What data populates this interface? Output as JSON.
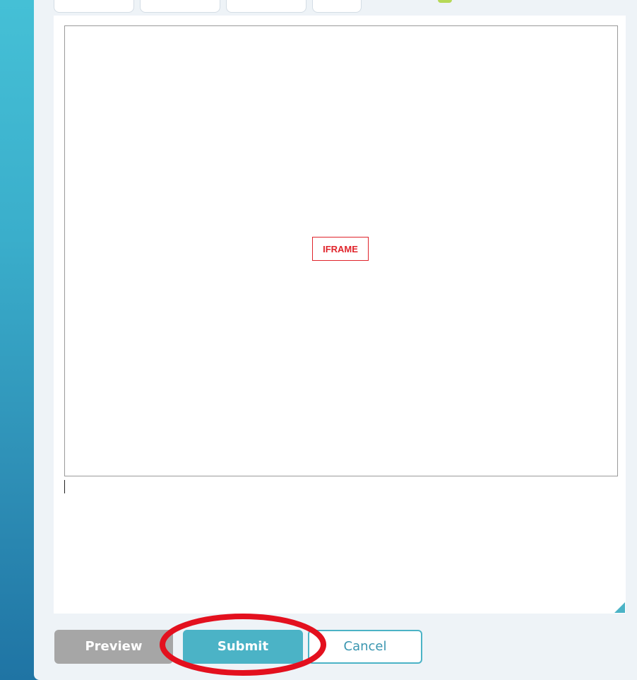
{
  "editor": {
    "iframe_placeholder": "IFRAME"
  },
  "actions": {
    "preview_label": "Preview",
    "submit_label": "Submit",
    "cancel_label": "Cancel"
  },
  "annotation": {
    "highlight_target": "submit-button",
    "highlight_color": "#e3101e"
  },
  "colors": {
    "accent": "#4bb3c6",
    "preview_button": "#a6a6a6",
    "card_background": "#eef3f7",
    "iframe_label": "#e0242b"
  }
}
